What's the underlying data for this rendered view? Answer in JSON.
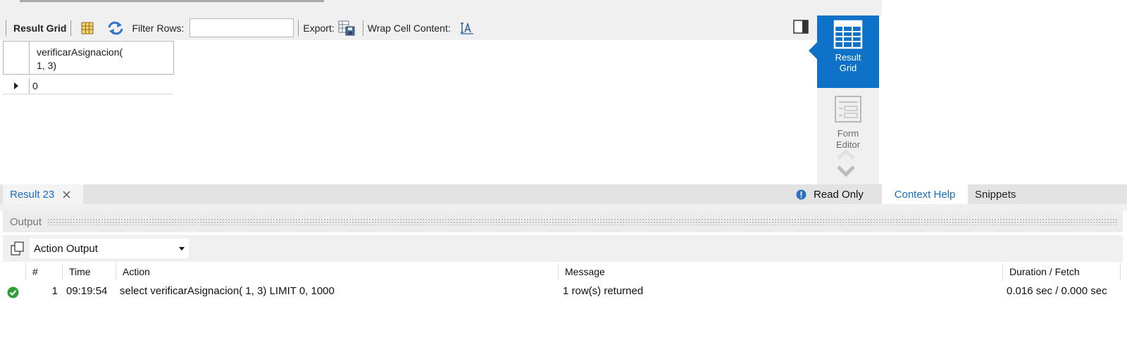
{
  "toolbar": {
    "result_grid_label": "Result Grid",
    "filter_label": "Filter Rows:",
    "filter_value": "",
    "export_label": "Export:",
    "wrap_label": "Wrap Cell Content:"
  },
  "grid": {
    "columns": [
      "verificarAsignacion(\n1, 3)"
    ],
    "rows": [
      [
        "0"
      ]
    ]
  },
  "side_panel": {
    "result_grid": "Result\nGrid",
    "form_editor": "Form\nEditor"
  },
  "result_tabs": {
    "active": "Result 23",
    "read_only": "Read Only"
  },
  "help_tabs": {
    "context_help": "Context Help",
    "snippets": "Snippets"
  },
  "output": {
    "title": "Output",
    "selector": "Action Output",
    "headers": [
      "#",
      "Time",
      "Action",
      "Message",
      "Duration / Fetch"
    ],
    "rows": [
      {
        "n": "1",
        "time": "09:19:54",
        "action": "select verificarAsignacion( 1, 3) LIMIT 0, 1000",
        "message": "1 row(s) returned",
        "duration": "0.016 sec / 0.000 sec"
      }
    ]
  },
  "colors": {
    "accent": "#0e73c8",
    "success": "#2e9e3a",
    "link": "#1a6fc0"
  }
}
